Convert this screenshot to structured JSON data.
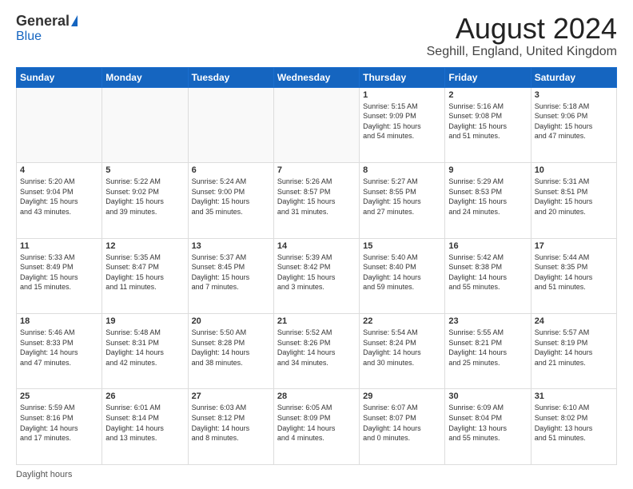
{
  "logo": {
    "general": "General",
    "blue": "Blue"
  },
  "title": "August 2024",
  "subtitle": "Seghill, England, United Kingdom",
  "days_of_week": [
    "Sunday",
    "Monday",
    "Tuesday",
    "Wednesday",
    "Thursday",
    "Friday",
    "Saturday"
  ],
  "footer_text": "Daylight hours",
  "weeks": [
    [
      {
        "day": "",
        "info": ""
      },
      {
        "day": "",
        "info": ""
      },
      {
        "day": "",
        "info": ""
      },
      {
        "day": "",
        "info": ""
      },
      {
        "day": "1",
        "info": "Sunrise: 5:15 AM\nSunset: 9:09 PM\nDaylight: 15 hours\nand 54 minutes."
      },
      {
        "day": "2",
        "info": "Sunrise: 5:16 AM\nSunset: 9:08 PM\nDaylight: 15 hours\nand 51 minutes."
      },
      {
        "day": "3",
        "info": "Sunrise: 5:18 AM\nSunset: 9:06 PM\nDaylight: 15 hours\nand 47 minutes."
      }
    ],
    [
      {
        "day": "4",
        "info": "Sunrise: 5:20 AM\nSunset: 9:04 PM\nDaylight: 15 hours\nand 43 minutes."
      },
      {
        "day": "5",
        "info": "Sunrise: 5:22 AM\nSunset: 9:02 PM\nDaylight: 15 hours\nand 39 minutes."
      },
      {
        "day": "6",
        "info": "Sunrise: 5:24 AM\nSunset: 9:00 PM\nDaylight: 15 hours\nand 35 minutes."
      },
      {
        "day": "7",
        "info": "Sunrise: 5:26 AM\nSunset: 8:57 PM\nDaylight: 15 hours\nand 31 minutes."
      },
      {
        "day": "8",
        "info": "Sunrise: 5:27 AM\nSunset: 8:55 PM\nDaylight: 15 hours\nand 27 minutes."
      },
      {
        "day": "9",
        "info": "Sunrise: 5:29 AM\nSunset: 8:53 PM\nDaylight: 15 hours\nand 24 minutes."
      },
      {
        "day": "10",
        "info": "Sunrise: 5:31 AM\nSunset: 8:51 PM\nDaylight: 15 hours\nand 20 minutes."
      }
    ],
    [
      {
        "day": "11",
        "info": "Sunrise: 5:33 AM\nSunset: 8:49 PM\nDaylight: 15 hours\nand 15 minutes."
      },
      {
        "day": "12",
        "info": "Sunrise: 5:35 AM\nSunset: 8:47 PM\nDaylight: 15 hours\nand 11 minutes."
      },
      {
        "day": "13",
        "info": "Sunrise: 5:37 AM\nSunset: 8:45 PM\nDaylight: 15 hours\nand 7 minutes."
      },
      {
        "day": "14",
        "info": "Sunrise: 5:39 AM\nSunset: 8:42 PM\nDaylight: 15 hours\nand 3 minutes."
      },
      {
        "day": "15",
        "info": "Sunrise: 5:40 AM\nSunset: 8:40 PM\nDaylight: 14 hours\nand 59 minutes."
      },
      {
        "day": "16",
        "info": "Sunrise: 5:42 AM\nSunset: 8:38 PM\nDaylight: 14 hours\nand 55 minutes."
      },
      {
        "day": "17",
        "info": "Sunrise: 5:44 AM\nSunset: 8:35 PM\nDaylight: 14 hours\nand 51 minutes."
      }
    ],
    [
      {
        "day": "18",
        "info": "Sunrise: 5:46 AM\nSunset: 8:33 PM\nDaylight: 14 hours\nand 47 minutes."
      },
      {
        "day": "19",
        "info": "Sunrise: 5:48 AM\nSunset: 8:31 PM\nDaylight: 14 hours\nand 42 minutes."
      },
      {
        "day": "20",
        "info": "Sunrise: 5:50 AM\nSunset: 8:28 PM\nDaylight: 14 hours\nand 38 minutes."
      },
      {
        "day": "21",
        "info": "Sunrise: 5:52 AM\nSunset: 8:26 PM\nDaylight: 14 hours\nand 34 minutes."
      },
      {
        "day": "22",
        "info": "Sunrise: 5:54 AM\nSunset: 8:24 PM\nDaylight: 14 hours\nand 30 minutes."
      },
      {
        "day": "23",
        "info": "Sunrise: 5:55 AM\nSunset: 8:21 PM\nDaylight: 14 hours\nand 25 minutes."
      },
      {
        "day": "24",
        "info": "Sunrise: 5:57 AM\nSunset: 8:19 PM\nDaylight: 14 hours\nand 21 minutes."
      }
    ],
    [
      {
        "day": "25",
        "info": "Sunrise: 5:59 AM\nSunset: 8:16 PM\nDaylight: 14 hours\nand 17 minutes."
      },
      {
        "day": "26",
        "info": "Sunrise: 6:01 AM\nSunset: 8:14 PM\nDaylight: 14 hours\nand 13 minutes."
      },
      {
        "day": "27",
        "info": "Sunrise: 6:03 AM\nSunset: 8:12 PM\nDaylight: 14 hours\nand 8 minutes."
      },
      {
        "day": "28",
        "info": "Sunrise: 6:05 AM\nSunset: 8:09 PM\nDaylight: 14 hours\nand 4 minutes."
      },
      {
        "day": "29",
        "info": "Sunrise: 6:07 AM\nSunset: 8:07 PM\nDaylight: 14 hours\nand 0 minutes."
      },
      {
        "day": "30",
        "info": "Sunrise: 6:09 AM\nSunset: 8:04 PM\nDaylight: 13 hours\nand 55 minutes."
      },
      {
        "day": "31",
        "info": "Sunrise: 6:10 AM\nSunset: 8:02 PM\nDaylight: 13 hours\nand 51 minutes."
      }
    ]
  ]
}
